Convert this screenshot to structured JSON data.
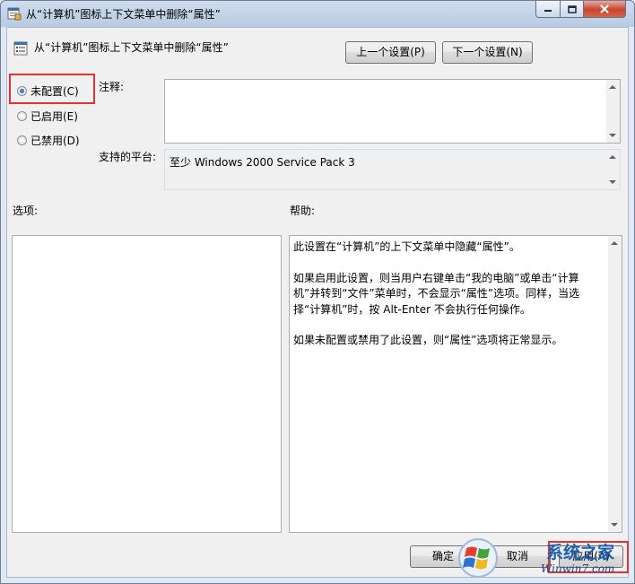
{
  "window": {
    "title": "从“计算机”图标上下文菜单中删除“属性”"
  },
  "header": {
    "title": "从“计算机”图标上下文菜单中删除“属性”",
    "prev_label": "上一个设置(P)",
    "next_label": "下一个设置(N)"
  },
  "state": {
    "options": [
      {
        "label": "未配置(C)",
        "checked": true
      },
      {
        "label": "已启用(E)",
        "checked": false
      },
      {
        "label": "已禁用(D)",
        "checked": false
      }
    ]
  },
  "comment": {
    "label": "注释:",
    "value": ""
  },
  "platform": {
    "label": "支持的平台:",
    "value": "至少 Windows 2000 Service Pack 3"
  },
  "options_panel": {
    "label": "选项:"
  },
  "help": {
    "label": "帮助:",
    "paragraphs": [
      "此设置在“计算机”的上下文菜单中隐藏“属性”。",
      "如果启用此设置，则当用户右键单击“我的电脑”或单击“计算机”并转到“文件”菜单时，不会显示“属性”选项。同样，当选择“计算机”时，按 Alt-Enter 不会执行任何操作。",
      "如果未配置或禁用了此设置，则“属性”选项将正常显示。"
    ]
  },
  "footer": {
    "ok_label": "确定",
    "cancel_label": "取消",
    "apply_label": "应用(A)"
  },
  "watermark": {
    "brand": "系统之家",
    "url": "Winwin7.com"
  }
}
